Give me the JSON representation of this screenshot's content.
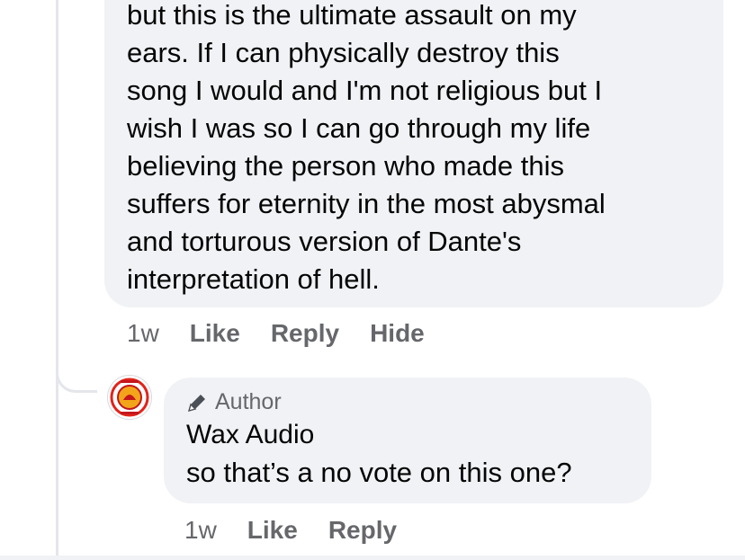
{
  "comment": {
    "text_lines": [
      "but this is the ultimate assault on my",
      "ears. If I can physically destroy this",
      "song I would and I'm not religious but I",
      "wish I was so I can go through my life",
      "believing the person who made this",
      "suffers for eternity in the most abysmal",
      "and torturous version of Dante's",
      "interpretation of hell."
    ],
    "time": "1w",
    "like_label": "Like",
    "reply_label": "Reply",
    "hide_label": "Hide"
  },
  "reply": {
    "badge": "Author",
    "author": "Wax Audio",
    "text": "so that’s a no vote on this one?",
    "time": "1w",
    "like_label": "Like",
    "reply_label": "Reply",
    "avatar_colors": {
      "ring": "#e2231a",
      "fill": "#f2a51a",
      "accent": "#c4161c"
    }
  },
  "icons": {
    "badge_icon": "pencil-icon"
  }
}
